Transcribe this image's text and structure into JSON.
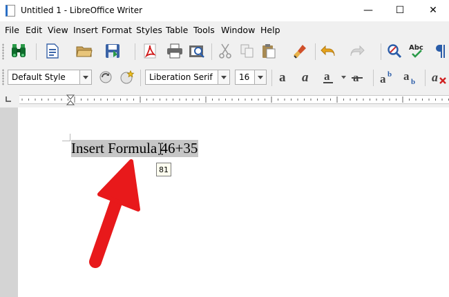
{
  "window": {
    "title": "Untitled 1 - LibreOffice Writer",
    "minimize_glyph": "—",
    "maximize_glyph": "☐",
    "close_glyph": "✕"
  },
  "menu": [
    "File",
    "Edit",
    "View",
    "Insert",
    "Format",
    "Styles",
    "Table",
    "Tools",
    "Window",
    "Help"
  ],
  "toolbar": {
    "icons": [
      "binoculars-icon",
      "new-document-icon",
      "open-folder-icon",
      "save-icon",
      "export-pdf-icon",
      "print-icon",
      "print-preview-icon",
      "cut-icon",
      "copy-icon",
      "paste-icon",
      "clone-formatting-icon",
      "undo-icon",
      "redo-icon",
      "find-replace-icon",
      "spelling-icon",
      "formatting-marks-icon"
    ],
    "spelling_label": "Abc"
  },
  "formatting": {
    "paragraph_style": "Default Style",
    "font_name": "Liberation Serif",
    "font_size": "16",
    "icons": [
      "update-style-icon",
      "new-style-icon",
      "bold-icon",
      "italic-icon",
      "underline-icon",
      "strikethrough-icon",
      "superscript-icon",
      "subscript-icon",
      "clear-formatting-icon"
    ]
  },
  "document": {
    "text": "Insert Formula 46+35",
    "tooltip": "81"
  },
  "colors": {
    "selection": "#c6c6c6",
    "arrow": "#e8191b",
    "toolbar_bg": "#f0f0f0"
  }
}
